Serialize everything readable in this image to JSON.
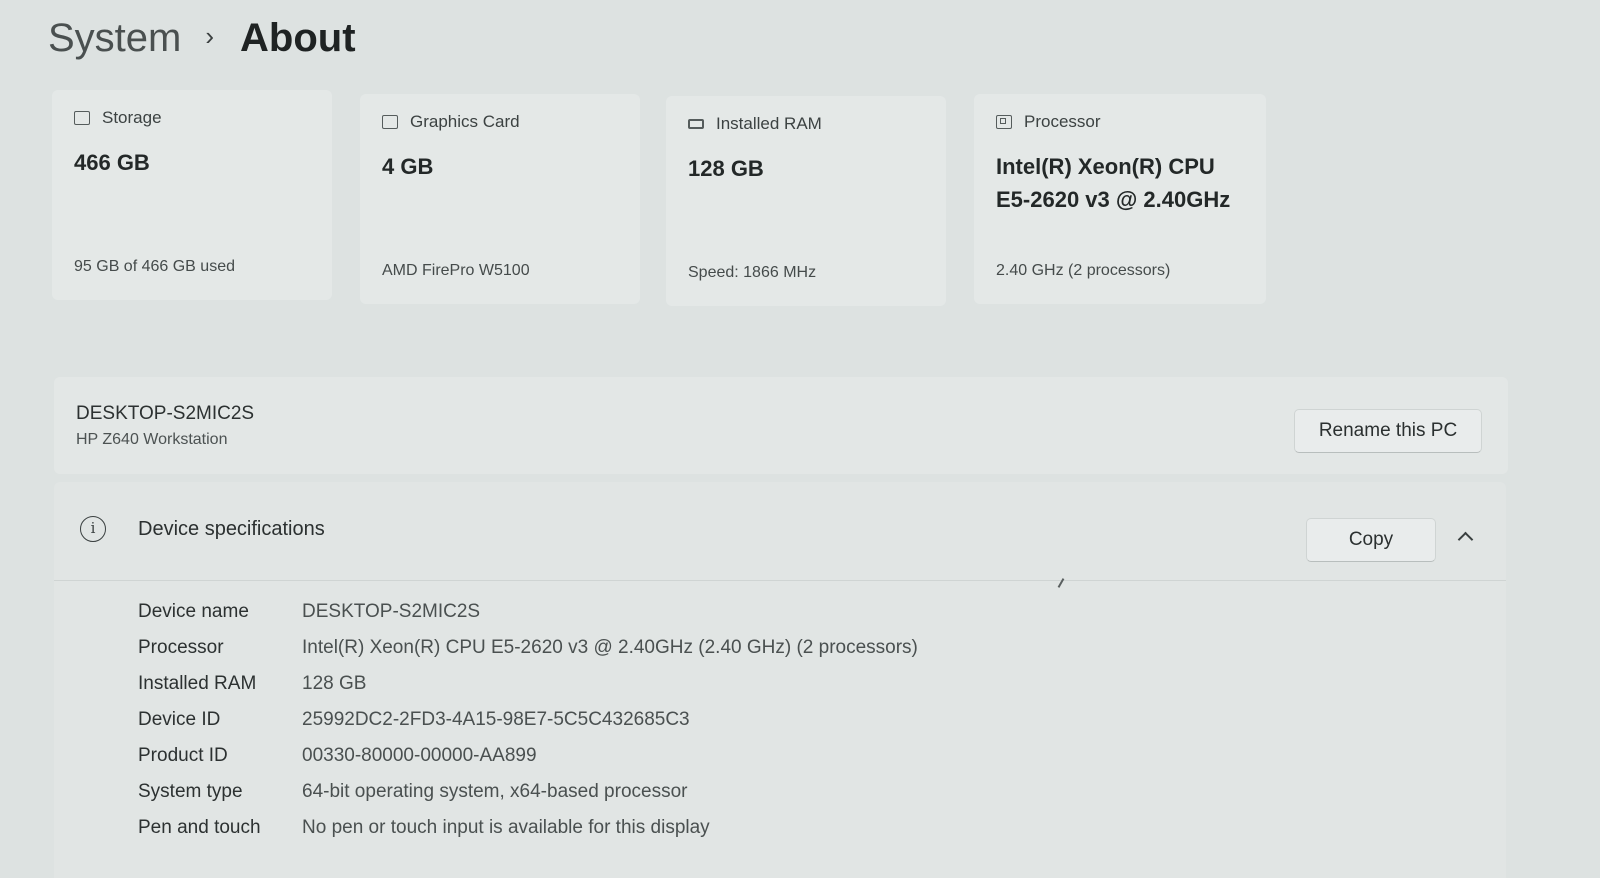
{
  "breadcrumb": {
    "parent": "System",
    "separator": "›",
    "current": "About"
  },
  "cards": [
    {
      "label": "Storage",
      "icon": "storage-icon",
      "value_line1": "466 GB",
      "value_line2": "",
      "sub": "95 GB of 466 GB used"
    },
    {
      "label": "Graphics Card",
      "icon": "graphics-card-icon",
      "value_line1": "4 GB",
      "value_line2": "",
      "sub": "AMD FirePro W5100"
    },
    {
      "label": "Installed RAM",
      "icon": "ram-icon",
      "value_line1": "128 GB",
      "value_line2": "",
      "sub": "Speed: 1866 MHz"
    },
    {
      "label": "Processor",
      "icon": "processor-icon",
      "value_line1": "Intel(R) Xeon(R) CPU",
      "value_line2": "E5-2620 v3 @ 2.40GHz",
      "sub": "2.40 GHz (2 processors)"
    }
  ],
  "pc": {
    "name": "DESKTOP-S2MIC2S",
    "model": "HP Z640 Workstation",
    "rename_label": "Rename this PC"
  },
  "specs": {
    "title": "Device specifications",
    "copy_label": "Copy",
    "rows": [
      {
        "label": "Device name",
        "value": "DESKTOP-S2MIC2S"
      },
      {
        "label": "Processor",
        "value": "Intel(R) Xeon(R) CPU E5-2620 v3 @ 2.40GHz (2.40 GHz) (2 processors)"
      },
      {
        "label": "Installed RAM",
        "value": "128 GB"
      },
      {
        "label": "Device ID",
        "value": "25992DC2-2FD3-4A15-98E7-5C5C432685C3"
      },
      {
        "label": "Product ID",
        "value": "00330-80000-00000-AA899"
      },
      {
        "label": "System type",
        "value": "64-bit operating system, x64-based processor"
      },
      {
        "label": "Pen and touch",
        "value": "No pen or touch input is available for this display"
      }
    ]
  }
}
